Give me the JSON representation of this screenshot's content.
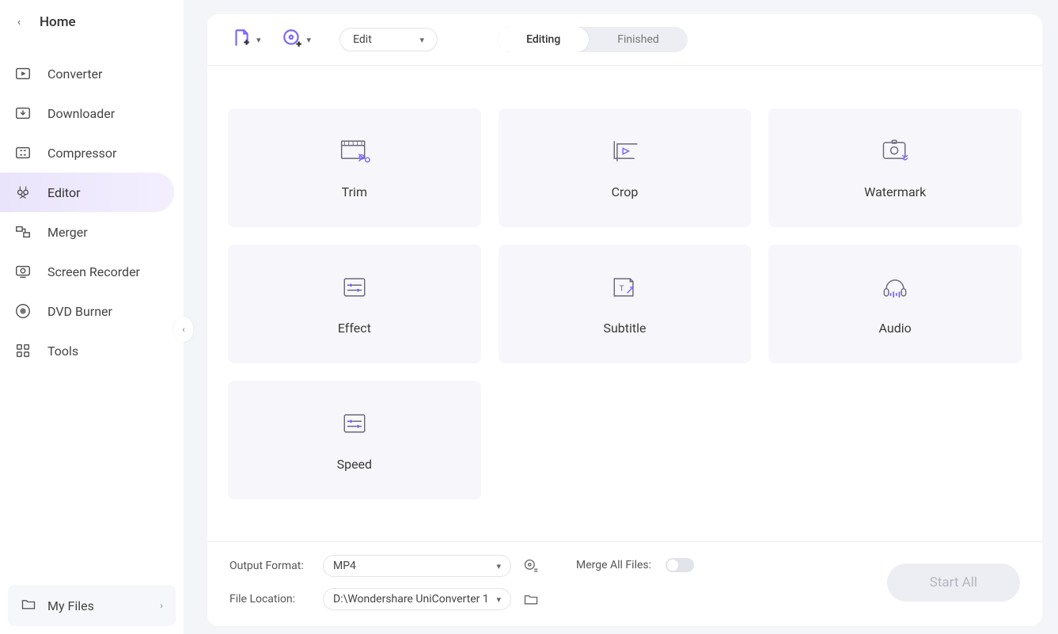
{
  "sidebar": {
    "home": "Home",
    "items": [
      {
        "label": "Converter",
        "icon": "converter-icon"
      },
      {
        "label": "Downloader",
        "icon": "downloader-icon"
      },
      {
        "label": "Compressor",
        "icon": "compressor-icon"
      },
      {
        "label": "Editor",
        "icon": "editor-icon",
        "active": true
      },
      {
        "label": "Merger",
        "icon": "merger-icon"
      },
      {
        "label": "Screen Recorder",
        "icon": "screen-recorder-icon"
      },
      {
        "label": "DVD Burner",
        "icon": "dvd-burner-icon"
      },
      {
        "label": "Tools",
        "icon": "tools-icon"
      }
    ],
    "my_files": "My Files"
  },
  "toolbar": {
    "edit_dropdown": "Edit",
    "tabs": {
      "editing": "Editing",
      "finished": "Finished"
    }
  },
  "tiles": [
    {
      "label": "Trim",
      "icon": "trim-icon",
      "name": "tile-trim"
    },
    {
      "label": "Crop",
      "icon": "crop-icon",
      "name": "tile-crop"
    },
    {
      "label": "Watermark",
      "icon": "watermark-icon",
      "name": "tile-watermark"
    },
    {
      "label": "Effect",
      "icon": "effect-icon",
      "name": "tile-effect"
    },
    {
      "label": "Subtitle",
      "icon": "subtitle-icon",
      "name": "tile-subtitle"
    },
    {
      "label": "Audio",
      "icon": "audio-icon",
      "name": "tile-audio"
    },
    {
      "label": "Speed",
      "icon": "speed-icon",
      "name": "tile-speed"
    }
  ],
  "footer": {
    "output_format_label": "Output Format:",
    "output_format_value": "MP4",
    "file_location_label": "File Location:",
    "file_location_value": "D:\\Wondershare UniConverter 1",
    "merge_label": "Merge All Files:",
    "start_button": "Start All"
  },
  "colors": {
    "accent": "#7b66ff"
  }
}
